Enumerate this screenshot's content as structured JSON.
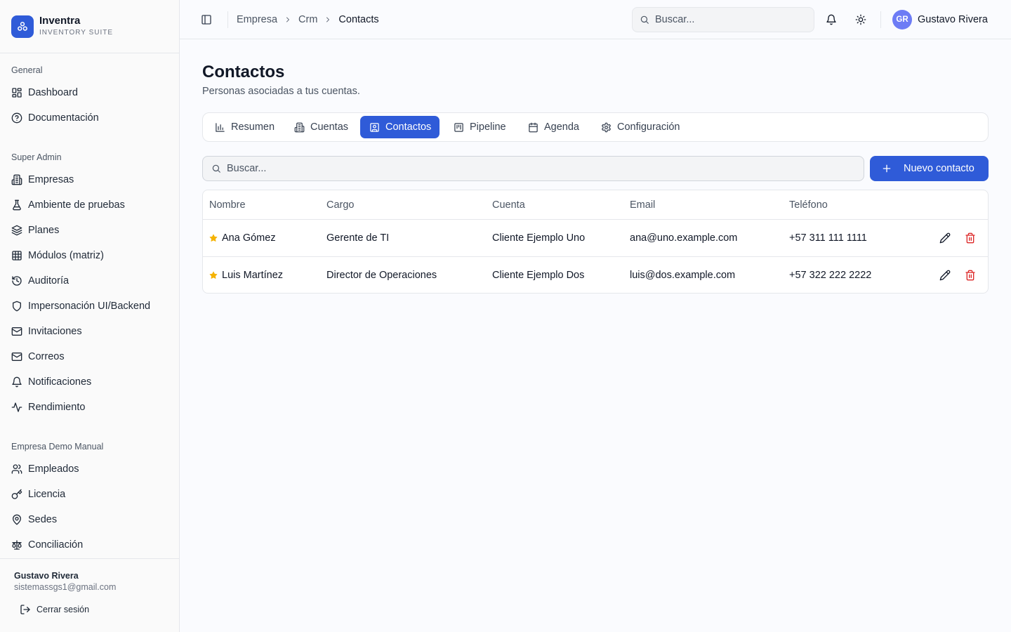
{
  "brand": {
    "name": "Inventra",
    "subtitle": "INVENTORY SUITE"
  },
  "sidebar": {
    "groups": [
      {
        "label": "General",
        "items": [
          {
            "label": "Dashboard",
            "icon": "grid-icon"
          },
          {
            "label": "Documentación",
            "icon": "help-circle-icon"
          }
        ]
      },
      {
        "label": "Super Admin",
        "items": [
          {
            "label": "Empresas",
            "icon": "building-icon"
          },
          {
            "label": "Ambiente de pruebas",
            "icon": "flask-icon"
          },
          {
            "label": "Planes",
            "icon": "layers-icon"
          },
          {
            "label": "Módulos (matriz)",
            "icon": "table-icon"
          },
          {
            "label": "Auditoría",
            "icon": "history-icon"
          },
          {
            "label": "Impersonación UI/Backend",
            "icon": "shield-icon"
          },
          {
            "label": "Invitaciones",
            "icon": "mail-icon"
          },
          {
            "label": "Correos",
            "icon": "mail-icon"
          },
          {
            "label": "Notificaciones",
            "icon": "bell-icon"
          },
          {
            "label": "Rendimiento",
            "icon": "activity-icon"
          }
        ]
      },
      {
        "label": "Empresa Demo Manual",
        "items": [
          {
            "label": "Empleados",
            "icon": "users-icon"
          },
          {
            "label": "Licencia",
            "icon": "key-icon"
          },
          {
            "label": "Sedes",
            "icon": "map-pin-icon"
          },
          {
            "label": "Conciliación",
            "icon": "scale-icon"
          }
        ]
      }
    ],
    "footer": {
      "name": "Gustavo Rivera",
      "email": "sistemassgs1@gmail.com",
      "logout_label": "Cerrar sesión"
    }
  },
  "topbar": {
    "breadcrumb": [
      "Empresa",
      "Crm",
      "Contacts"
    ],
    "search_placeholder": "Buscar...",
    "user": {
      "initials": "GR",
      "name": "Gustavo Rivera"
    }
  },
  "main": {
    "title": "Contactos",
    "subtitle": "Personas asociadas a tus cuentas.",
    "tabs": [
      {
        "label": "Resumen",
        "icon": "bar-chart-icon"
      },
      {
        "label": "Cuentas",
        "icon": "building-icon"
      },
      {
        "label": "Contactos",
        "icon": "contact-icon",
        "active": true
      },
      {
        "label": "Pipeline",
        "icon": "kanban-icon"
      },
      {
        "label": "Agenda",
        "icon": "calendar-icon"
      },
      {
        "label": "Configuración",
        "icon": "gear-icon"
      }
    ],
    "search_placeholder": "Buscar...",
    "new_button_label": "Nuevo contacto",
    "table": {
      "headers": [
        "Nombre",
        "Cargo",
        "Cuenta",
        "Email",
        "Teléfono"
      ],
      "rows": [
        {
          "name": "Ana Gómez",
          "role": "Gerente de TI",
          "account": "Cliente Ejemplo Uno",
          "email": "ana@uno.example.com",
          "phone": "+57 311 111 1111",
          "starred": true
        },
        {
          "name": "Luis Martínez",
          "role": "Director de Operaciones",
          "account": "Cliente Ejemplo Dos",
          "email": "luis@dos.example.com",
          "phone": "+57 322 222 2222",
          "starred": true
        }
      ]
    }
  },
  "colors": {
    "accent": "#2f5bd8",
    "star": "#f5b301",
    "danger": "#dc2626",
    "avatar": "#6d7cf5"
  }
}
